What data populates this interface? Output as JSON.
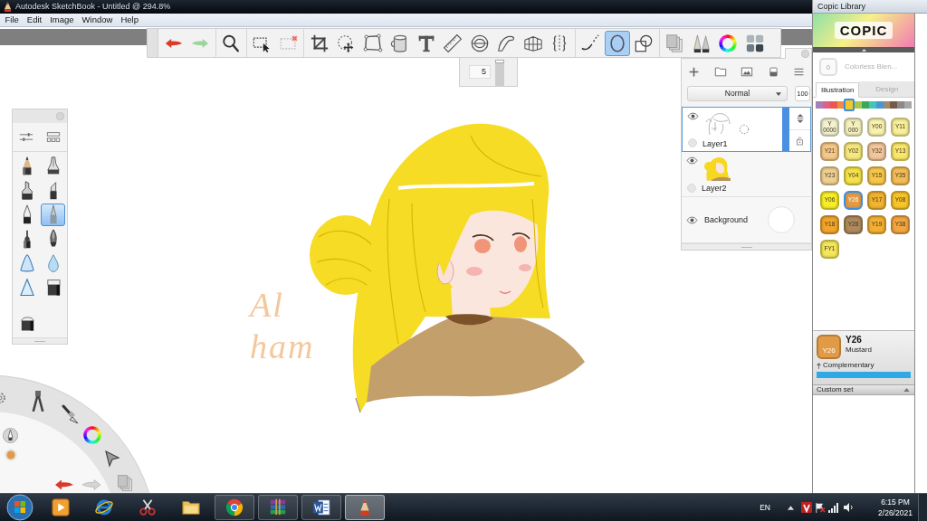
{
  "window": {
    "title": "Autodesk SketchBook - Untitled @ 294.8%"
  },
  "menu": [
    "File",
    "Edit",
    "Image",
    "Window",
    "Help"
  ],
  "toolbar": {
    "groups": [
      {
        "tools": [
          {
            "selected": false
          },
          {
            "selected": false
          }
        ]
      },
      {
        "tools": [
          {
            "selected": false
          }
        ]
      },
      {
        "tools": [
          {
            "selected": false
          },
          {
            "selected": false
          }
        ]
      },
      {
        "tools": [
          {
            "selected": false
          },
          {
            "selected": false
          },
          {
            "selected": false
          },
          {
            "selected": false
          },
          {
            "selected": false
          },
          {
            "selected": false
          },
          {
            "selected": false
          },
          {
            "selected": false
          },
          {
            "selected": false
          },
          {
            "selected": false
          }
        ]
      },
      {
        "tools": [
          {
            "selected": false
          },
          {
            "selected": true
          },
          {
            "selected": false
          }
        ]
      },
      {
        "tools": [
          {
            "selected": false
          },
          {
            "selected": false
          },
          {
            "selected": false
          },
          {
            "selected": false
          }
        ]
      }
    ]
  },
  "brush_size": {
    "value": "5",
    "level": 0.95
  },
  "brush_palette": {
    "brushes": [
      {
        "selected": false
      },
      {
        "selected": false
      },
      {
        "selected": false
      },
      {
        "selected": false
      },
      {
        "selected": false
      },
      {
        "selected": true
      },
      {
        "selected": false
      },
      {
        "selected": false
      },
      {
        "selected": false
      },
      {
        "selected": false
      },
      {
        "selected": false
      },
      {
        "selected": false
      },
      {
        "selected": false
      }
    ]
  },
  "canvas": {
    "handwriting": [
      "Al",
      "ham"
    ]
  },
  "layers": {
    "blend_mode": "Normal",
    "opacity": "100",
    "items": [
      {
        "kind": "layer",
        "name": "Layer1",
        "visible": true,
        "selected": true
      },
      {
        "kind": "layer",
        "name": "Layer2",
        "visible": true,
        "selected": false
      },
      {
        "kind": "background",
        "name": "Background",
        "visible": true,
        "selected": false
      }
    ]
  },
  "copic": {
    "title": "Copic Library",
    "logo": "COPIC",
    "blender": {
      "code": "0",
      "name": "Colorless Blen..."
    },
    "tabs": [
      {
        "label": "Illustration",
        "selected": true
      },
      {
        "label": "Design",
        "selected": false
      }
    ],
    "hues": [
      {
        "color": "#a880b8",
        "selected": false
      },
      {
        "color": "#e0608a",
        "selected": false
      },
      {
        "color": "#e8584c",
        "selected": false
      },
      {
        "color": "#f08a44",
        "selected": false
      },
      {
        "color": "#f5c828",
        "selected": true
      },
      {
        "color": "#a8c84a",
        "selected": false
      },
      {
        "color": "#3aa858",
        "selected": false
      },
      {
        "color": "#44c4b8",
        "selected": false
      },
      {
        "color": "#4898d0",
        "selected": false
      },
      {
        "color": "#a08a70",
        "selected": false
      },
      {
        "color": "#7a5848",
        "selected": false
      },
      {
        "color": "#8a8a8a",
        "selected": false
      },
      {
        "color": "#a8a8a8",
        "selected": false
      }
    ],
    "swatches": [
      {
        "code": "Y 0000",
        "color": "#f3f1cf",
        "selected": false
      },
      {
        "code": "Y 000",
        "color": "#f4f0c0",
        "selected": false
      },
      {
        "code": "Y00",
        "color": "#f8f2b0",
        "selected": false
      },
      {
        "code": "Y11",
        "color": "#f9ef98",
        "selected": false
      },
      {
        "code": "Y21",
        "color": "#f6c888",
        "selected": false
      },
      {
        "code": "Y02",
        "color": "#f6e87e",
        "selected": false
      },
      {
        "code": "Y32",
        "color": "#f3c79b",
        "selected": false
      },
      {
        "code": "Y13",
        "color": "#f9e66a",
        "selected": false
      },
      {
        "code": "Y23",
        "color": "#efcf91",
        "selected": false
      },
      {
        "code": "Y04",
        "color": "#f5e24a",
        "selected": false
      },
      {
        "code": "Y15",
        "color": "#f7c74a",
        "selected": false
      },
      {
        "code": "Y35",
        "color": "#f2bd58",
        "selected": false
      },
      {
        "code": "Y06",
        "color": "#f8ee28",
        "selected": false
      },
      {
        "code": "Y26",
        "color": "#e19a45",
        "selected": true
      },
      {
        "code": "Y17",
        "color": "#f2b330",
        "selected": false
      },
      {
        "code": "Y08",
        "color": "#f7c42a",
        "selected": false
      },
      {
        "code": "Y18",
        "color": "#f2a52a",
        "selected": false
      },
      {
        "code": "Y28",
        "color": "#ae8a5e",
        "selected": false
      },
      {
        "code": "Y19",
        "color": "#f4b032",
        "selected": false
      },
      {
        "code": "Y38",
        "color": "#f2a640",
        "selected": false
      },
      {
        "code": "FY1",
        "color": "#f5e65a",
        "selected": false
      }
    ],
    "current": {
      "chip_code": "Y26",
      "code": "Y26",
      "name": "Mustard"
    },
    "complementary": "Complementary",
    "custom_set": "Custom set"
  },
  "taskbar": {
    "apps": [
      {
        "running": false,
        "active": false
      },
      {
        "running": false,
        "active": false
      },
      {
        "running": false,
        "active": false
      },
      {
        "running": false,
        "active": false
      },
      {
        "running": true,
        "active": false
      },
      {
        "running": true,
        "active": false
      },
      {
        "running": true,
        "active": false
      },
      {
        "running": true,
        "active": true
      }
    ],
    "language": "EN",
    "time": "6:15 PM",
    "date": "2/26/2021"
  }
}
